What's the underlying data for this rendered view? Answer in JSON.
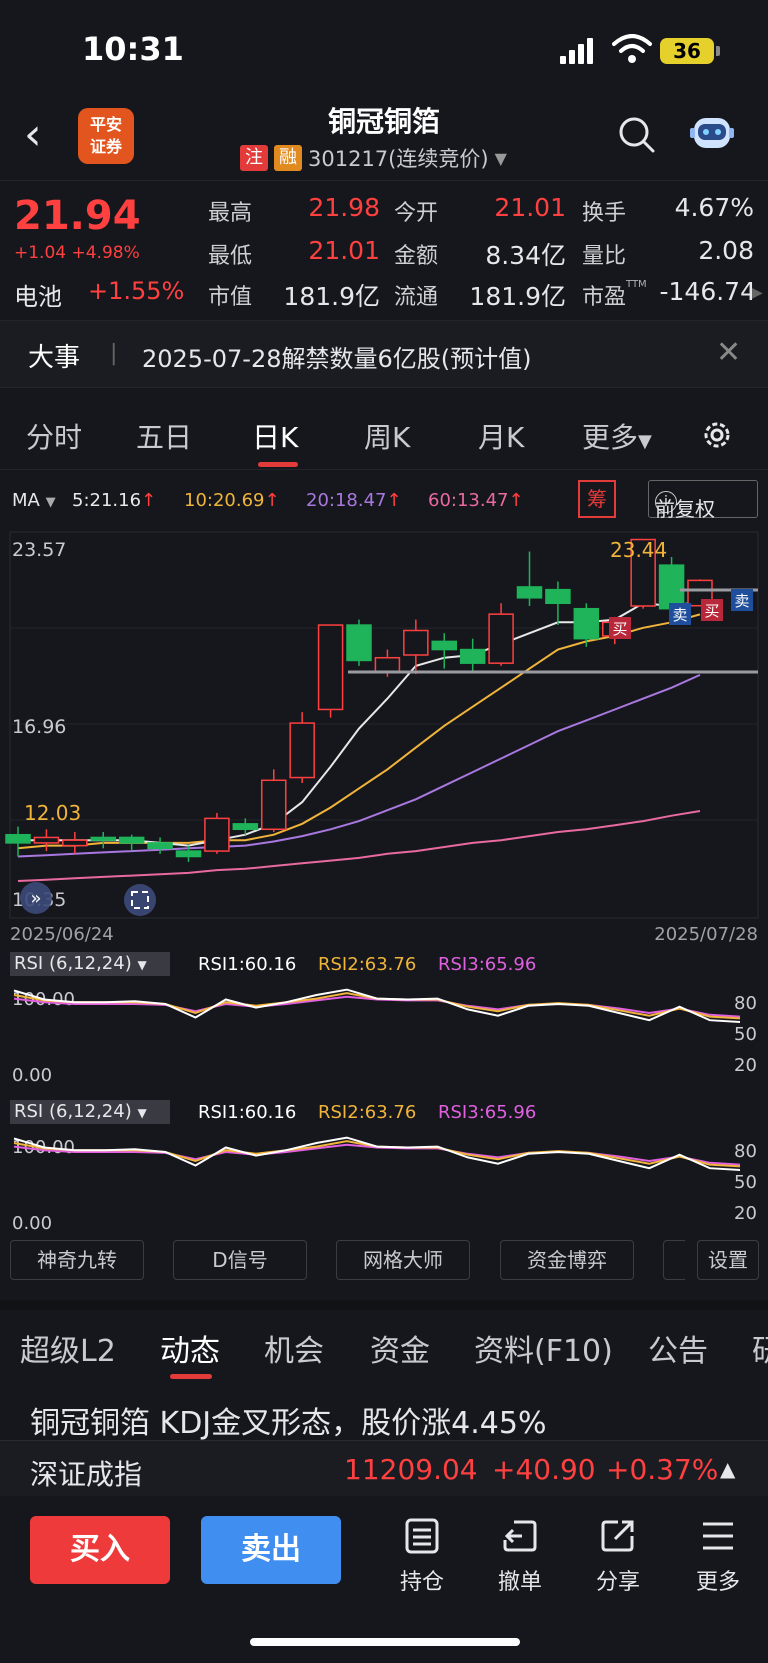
{
  "status_bar": {
    "time": "10:31",
    "battery": "36"
  },
  "header": {
    "logo_text_1": "平安",
    "logo_text_2": "证券",
    "stock_name": "铜冠铜箔",
    "tag_1": "注",
    "tag_2": "融",
    "stock_code": "301217(连续竞价)"
  },
  "quote": {
    "price": "21.94",
    "change": "+1.04 +4.98%",
    "sector_label": "电池",
    "sector_change": "+1.55%",
    "labels": {
      "high": "最高",
      "open": "今开",
      "turnover": "换手",
      "low": "最低",
      "amount": "金额",
      "vol_ratio": "量比",
      "mktcap": "市值",
      "float": "流通",
      "pe": "市盈"
    },
    "values": {
      "high": "21.98",
      "open": "21.01",
      "turnover": "4.67%",
      "low": "21.01",
      "amount": "8.34亿",
      "vol_ratio": "2.08",
      "mktcap": "181.9亿",
      "float": "181.9亿",
      "pe": "-146.74"
    },
    "pe_suffix": "TTM"
  },
  "event": {
    "tag": "大事",
    "text": "2025-07-28解禁数量6亿股(预计值)"
  },
  "chart_tabs": [
    "分时",
    "五日",
    "日K",
    "周K",
    "月K",
    "更多"
  ],
  "chart_tabs_active": "日K",
  "ma": {
    "label": "MA",
    "ma5": "5:21.16",
    "ma10": "10:20.69",
    "ma20": "20:18.47",
    "ma60": "60:13.47",
    "chou_label": "筹",
    "adjust_label": "前复权"
  },
  "chart_data": {
    "type": "candlestick",
    "y_max_label": "23.57",
    "y_mid_label": "16.96",
    "y_min_label": "10.35",
    "start_date": "2025/06/24",
    "end_date": "2025/07/28",
    "high_annotation": "23.44",
    "low_annotation": "12.03",
    "candles": [
      {
        "o": 12.6,
        "c": 12.3,
        "h": 12.9,
        "l": 11.8
      },
      {
        "o": 12.3,
        "c": 12.5,
        "h": 12.8,
        "l": 12.0
      },
      {
        "o": 12.2,
        "c": 12.4,
        "h": 12.7,
        "l": 11.9
      },
      {
        "o": 12.5,
        "c": 12.4,
        "h": 12.7,
        "l": 12.1
      },
      {
        "o": 12.5,
        "c": 12.3,
        "h": 12.6,
        "l": 12.0
      },
      {
        "o": 12.3,
        "c": 12.1,
        "h": 12.5,
        "l": 11.9
      },
      {
        "o": 12.0,
        "c": 11.8,
        "h": 12.2,
        "l": 11.6
      },
      {
        "o": 12.0,
        "c": 13.2,
        "h": 13.4,
        "l": 11.9
      },
      {
        "o": 13.0,
        "c": 12.8,
        "h": 13.2,
        "l": 12.6
      },
      {
        "o": 12.8,
        "c": 14.6,
        "h": 15.0,
        "l": 12.7
      },
      {
        "o": 14.7,
        "c": 16.7,
        "h": 17.1,
        "l": 14.5
      },
      {
        "o": 17.2,
        "c": 20.3,
        "h": 20.3,
        "l": 16.9
      },
      {
        "o": 20.3,
        "c": 19.0,
        "h": 20.5,
        "l": 18.8
      },
      {
        "o": 18.6,
        "c": 19.1,
        "h": 19.4,
        "l": 18.4
      },
      {
        "o": 19.2,
        "c": 20.1,
        "h": 20.5,
        "l": 18.5
      },
      {
        "o": 19.7,
        "c": 19.4,
        "h": 20.0,
        "l": 18.7
      },
      {
        "o": 19.4,
        "c": 18.9,
        "h": 19.8,
        "l": 18.6
      },
      {
        "o": 18.9,
        "c": 20.7,
        "h": 21.1,
        "l": 18.8
      },
      {
        "o": 21.7,
        "c": 21.3,
        "h": 23.0,
        "l": 21.0
      },
      {
        "o": 21.6,
        "c": 21.1,
        "h": 21.9,
        "l": 20.3
      },
      {
        "o": 20.9,
        "c": 19.8,
        "h": 21.1,
        "l": 19.5
      },
      {
        "o": 19.9,
        "c": 20.4,
        "h": 20.6,
        "l": 19.6
      },
      {
        "o": 21.0,
        "c": 23.44,
        "h": 23.44,
        "l": 20.9
      },
      {
        "o": 22.5,
        "c": 20.9,
        "h": 22.8,
        "l": 20.6
      },
      {
        "o": 21.01,
        "c": 21.94,
        "h": 21.98,
        "l": 21.01
      }
    ],
    "ma5": [
      12.4,
      12.4,
      12.4,
      12.4,
      12.4,
      12.3,
      12.2,
      12.4,
      12.6,
      13.0,
      13.8,
      15.1,
      16.5,
      17.6,
      18.8,
      19.1,
      19.2,
      19.6,
      20.0,
      20.4,
      20.4,
      20.5,
      21.1,
      21.0,
      21.16
    ],
    "ma10": [
      12.1,
      12.2,
      12.2,
      12.3,
      12.3,
      12.3,
      12.3,
      12.4,
      12.4,
      12.6,
      13.0,
      13.6,
      14.3,
      15.0,
      15.8,
      16.6,
      17.3,
      18.0,
      18.7,
      19.4,
      19.7,
      19.9,
      20.2,
      20.4,
      20.69
    ],
    "ma20": [
      11.8,
      11.85,
      11.9,
      11.95,
      12.0,
      12.05,
      12.1,
      12.15,
      12.2,
      12.35,
      12.55,
      12.8,
      13.1,
      13.5,
      13.9,
      14.4,
      14.9,
      15.4,
      15.9,
      16.4,
      16.8,
      17.2,
      17.6,
      18.0,
      18.47
    ],
    "ma60": [
      10.9,
      10.95,
      11.0,
      11.05,
      11.1,
      11.15,
      11.2,
      11.3,
      11.35,
      11.45,
      11.55,
      11.65,
      11.75,
      11.9,
      12.0,
      12.15,
      12.3,
      12.4,
      12.55,
      12.7,
      12.8,
      12.95,
      13.1,
      13.3,
      13.47
    ],
    "signals": [
      {
        "label": "买",
        "type": "buy"
      },
      {
        "label": "卖",
        "type": "sell"
      },
      {
        "label": "买",
        "type": "buy"
      },
      {
        "label": "卖",
        "type": "sell"
      }
    ]
  },
  "rsi_panels": [
    {
      "selector": "RSI (6,12,24)",
      "rsi1": "RSI1:60.16",
      "rsi2": "RSI2:63.76",
      "rsi3": "RSI3:65.96",
      "top_label": "100.00",
      "bottom_label": "0.00",
      "levels": [
        "80",
        "50",
        "20"
      ]
    },
    {
      "selector": "RSI (6,12,24)",
      "rsi1": "RSI1:60.16",
      "rsi2": "RSI2:63.76",
      "rsi3": "RSI3:65.96",
      "top_label": "100.00",
      "bottom_label": "0.00",
      "levels": [
        "80",
        "50",
        "20"
      ]
    }
  ],
  "rsi_series": {
    "rsi1": [
      95,
      85,
      82,
      82,
      83,
      80,
      65,
      85,
      76,
      82,
      90,
      96,
      86,
      85,
      86,
      74,
      67,
      78,
      80,
      78,
      70,
      62,
      77,
      62,
      60
    ],
    "rsi2": [
      90,
      84,
      82,
      82,
      82,
      80,
      70,
      82,
      78,
      82,
      86,
      92,
      86,
      85,
      85,
      77,
      72,
      79,
      81,
      79,
      73,
      67,
      75,
      66,
      64
    ],
    "rsi3": [
      86,
      82,
      80,
      80,
      80,
      79,
      72,
      80,
      77,
      80,
      84,
      88,
      85,
      84,
      84,
      78,
      74,
      79,
      80,
      79,
      75,
      70,
      75,
      68,
      66
    ]
  },
  "indicator_buttons": [
    "神奇九转",
    "D信号",
    "网格大师",
    "资金博弈",
    "设置"
  ],
  "sub_tabs": [
    "超级L2",
    "动态",
    "机会",
    "资金",
    "资料(F10)",
    "公告",
    "研"
  ],
  "sub_tabs_active": "动态",
  "news_headline": "铜冠铜箔 KDJ金叉形态，股价涨4.45%",
  "index": {
    "name": "深证成指",
    "value": "11209.04",
    "change": "+40.90",
    "pct": "+0.37%"
  },
  "bottom": {
    "buy": "买入",
    "sell": "卖出",
    "holdings": "持仓",
    "cancel": "撤单",
    "share": "分享",
    "more": "更多"
  },
  "colors": {
    "up": "#ff4040",
    "down": "#1fb35a",
    "ma5": "#e8e8e8",
    "ma10": "#f0b43a",
    "ma20": "#a878e0",
    "ma60": "#e86aa0"
  }
}
